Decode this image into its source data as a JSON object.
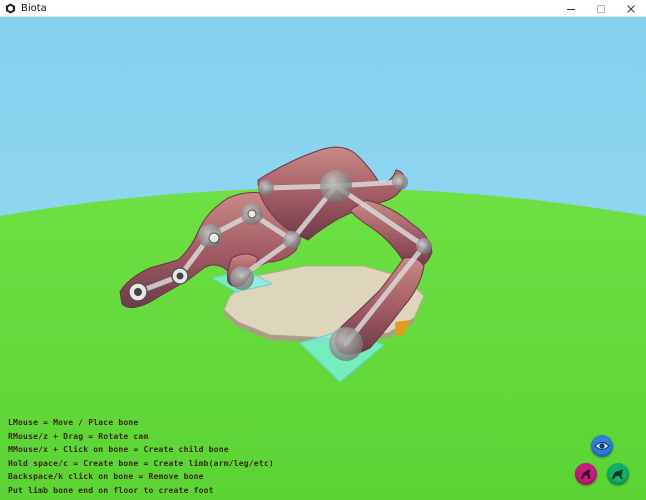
{
  "window": {
    "title": "Biota",
    "icon": "unity-cube-icon",
    "controls": [
      "minimize-icon",
      "maximize-icon",
      "close-icon"
    ]
  },
  "scene": {
    "sky_color": "#86d3ef",
    "ground_color": "#66dd3d",
    "creature_color": "#a45d66",
    "platform_color": "#dcd4ba",
    "foot_marker_color": "#7ef2e8"
  },
  "instructions": [
    "LMouse = Move / Place bone",
    "RMouse/z + Drag = Rotate cam",
    "MMouse/x + Click on bone = Create child bone",
    "Hold space/c = Create bone = Create limb(arm/leg/etc)",
    "Backspace/k click on bone = Remove bone",
    "Put limb bone end on floor to create foot"
  ],
  "toolbar": {
    "view_button": {
      "icon": "eye-icon",
      "color": "#2f7fd6"
    },
    "creature_button": {
      "icon": "creature-icon",
      "color": "#c81d7a"
    },
    "walk_button": {
      "icon": "running-creature-icon",
      "color": "#12b06a"
    }
  }
}
